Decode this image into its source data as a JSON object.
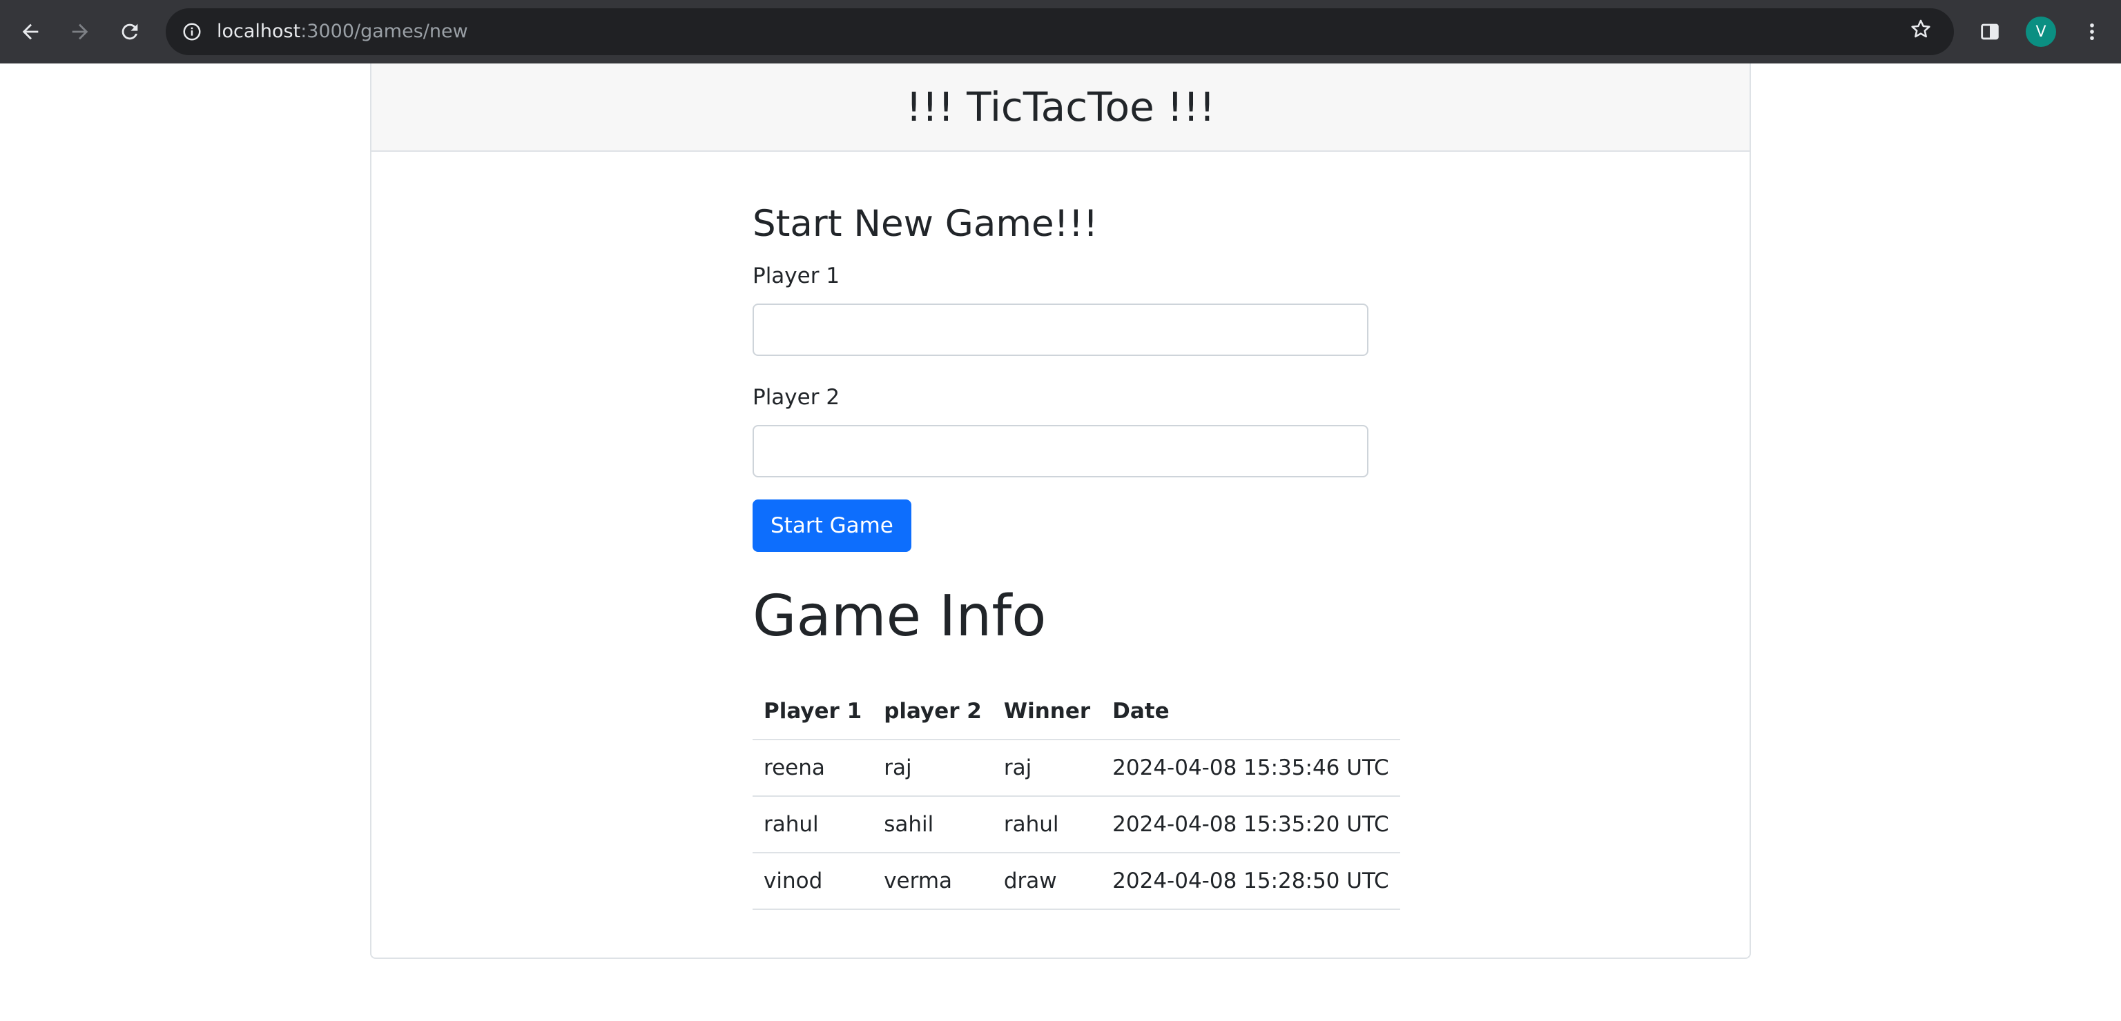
{
  "browser": {
    "url_host": "localhost",
    "url_path": ":3000/games/new",
    "avatar_letter": "V"
  },
  "header": {
    "title": "!!! TicTacToe !!!"
  },
  "form": {
    "title": "Start New Game!!!",
    "player1_label": "Player 1",
    "player1_value": "",
    "player2_label": "Player 2",
    "player2_value": "",
    "submit_label": "Start Game"
  },
  "game_info": {
    "title": "Game Info",
    "columns": [
      "Player 1",
      "player 2",
      "Winner",
      "Date"
    ],
    "rows": [
      [
        "reena",
        "raj",
        "raj",
        "2024-04-08 15:35:46 UTC"
      ],
      [
        "rahul",
        "sahil",
        "rahul",
        "2024-04-08 15:35:20 UTC"
      ],
      [
        "vinod",
        "verma",
        "draw",
        "2024-04-08 15:28:50 UTC"
      ]
    ]
  },
  "colors": {
    "primary_button": "#0d6efd",
    "browser_bar": "#35363a",
    "avatar": "#0b8f82"
  }
}
